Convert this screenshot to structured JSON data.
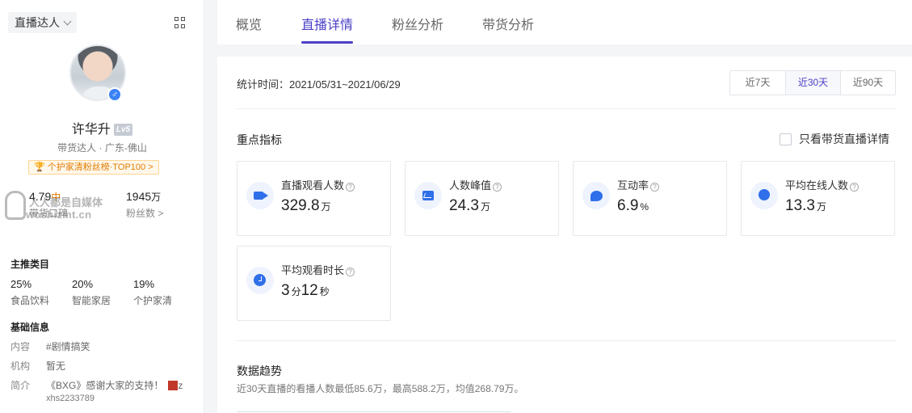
{
  "sidebar": {
    "role_select": "直播达人",
    "profile": {
      "name": "许华升",
      "level": "Lv5",
      "tags": "带货达人 · 广东-佛山",
      "rank": "个护家清粉丝榜·TOP100 >"
    },
    "stats": {
      "score_value": "4.79",
      "score_suffix": "中",
      "score_label": "带货口碑",
      "fans_value": "1945",
      "fans_unit": "万",
      "fans_label": "粉丝数 >"
    },
    "watermark": {
      "cn": "人人都是自媒体",
      "en": "woshizmt.cn"
    },
    "main_categories": {
      "title": "主推类目",
      "items": [
        {
          "pct": "25%",
          "name": "食品饮料"
        },
        {
          "pct": "20%",
          "name": "智能家居"
        },
        {
          "pct": "19%",
          "name": "个护家清"
        }
      ]
    },
    "basic_info": {
      "title": "基础信息",
      "rows": [
        {
          "k": "内容",
          "v": "#剧情搞笑"
        },
        {
          "k": "机构",
          "v": "暂无"
        },
        {
          "k": "简介",
          "v": "《BXG》感谢大家的支持！",
          "v2": "z",
          "v3": "xhs2233789"
        }
      ]
    }
  },
  "tabs": [
    "概览",
    "直播详情",
    "粉丝分析",
    "带货分析"
  ],
  "active_tab": 1,
  "panel": {
    "stat_time": "统计时间：2021/05/31~2021/06/29",
    "ranges": [
      "近7天",
      "近30天",
      "近90天"
    ],
    "active_range": 1,
    "key_title": "重点指标",
    "only_goods_label": "只看带货直播详情",
    "cards": [
      {
        "title": "直播观看人数",
        "value": "329.8",
        "unit": "万",
        "icon": "video-icon"
      },
      {
        "title": "人数峰值",
        "value": "24.3",
        "unit": "万",
        "icon": "pulse-chart-icon"
      },
      {
        "title": "互动率",
        "value": "6.9",
        "unit": "%",
        "icon": "chat-bubble-icon"
      },
      {
        "title": "平均在线人数",
        "value": "13.3",
        "unit": "万",
        "icon": "user-icon"
      },
      {
        "title": "平均观看时长",
        "value": "3",
        "unit": "分",
        "value2": "12",
        "unit2": "秒",
        "icon": "clock-icon"
      }
    ],
    "trend_title": "数据趋势",
    "trend_desc": "近30天直播的看播人数最低85.6万，最高588.2万，均值268.79万。"
  },
  "colors": {
    "accent": "#4b3fc7",
    "icon_blue": "#2f6fe9",
    "rank_orange": "#e07b00"
  }
}
